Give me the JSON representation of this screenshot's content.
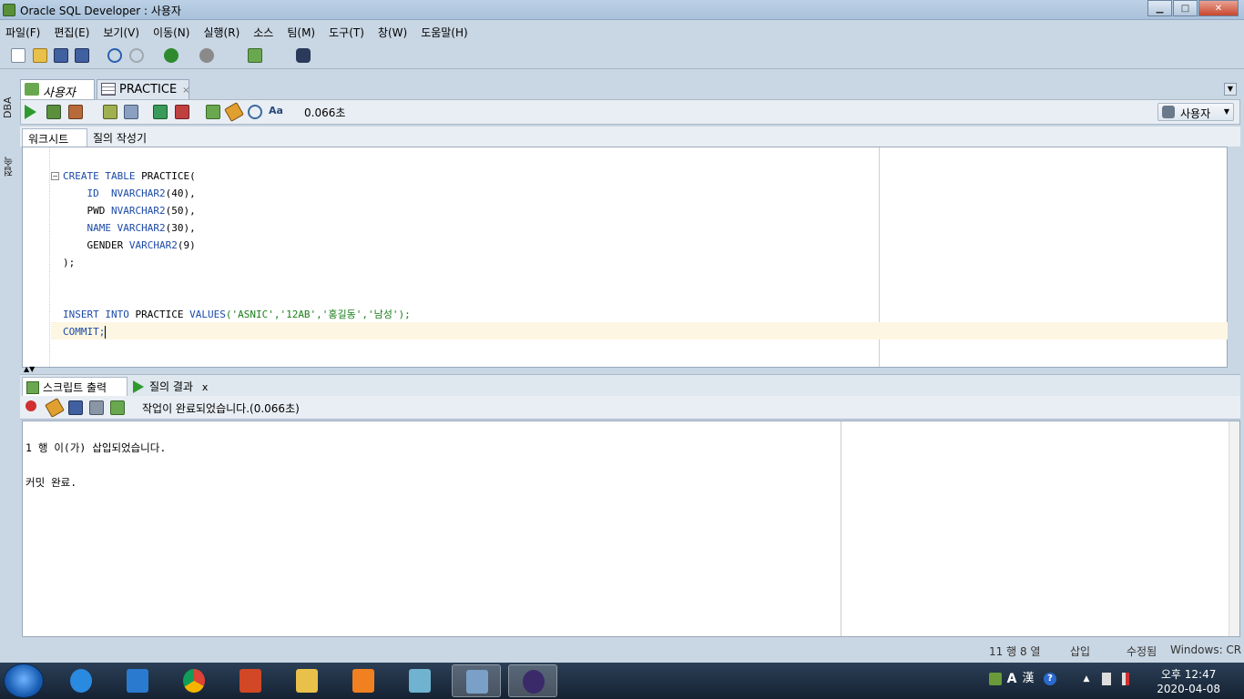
{
  "window": {
    "title": "Oracle SQL Developer : 사용자",
    "minimize": "▁",
    "maximize": "□",
    "close": "✕"
  },
  "menu": [
    "파일(F)",
    "편집(E)",
    "보기(V)",
    "이동(N)",
    "실행(R)",
    "소스",
    "팀(M)",
    "도구(T)",
    "창(W)",
    "도움말(H)"
  ],
  "side_tabs": [
    "DBA",
    "접속"
  ],
  "editor_tabs": [
    {
      "label": "사용자",
      "close": "×"
    },
    {
      "label": "PRACTICE",
      "close": "×"
    }
  ],
  "editor_toolbar": {
    "timing": "0.066초",
    "connection": "사용자"
  },
  "sub_tabs": [
    "워크시트",
    "질의 작성기"
  ],
  "code_lines": {
    "l1_kw": "CREATE TABLE",
    "l1_rest": " PRACTICE(",
    "l2_col": "ID",
    "l2_type": "NVARCHAR2",
    "l2_rest": "(40),",
    "l3_col": "PWD",
    "l3_type": "NVARCHAR2",
    "l3_rest": "(50),",
    "l4_col": "NAME",
    "l4_type": "VARCHAR2",
    "l4_rest": "(30),",
    "l5_col": "GENDER",
    "l5_type": "VARCHAR2",
    "l5_rest": "(9)",
    "l6": ");",
    "l9_kw1": "INSERT INTO",
    "l9_tbl": " PRACTICE ",
    "l9_kw2": "VALUES",
    "l9_vals": "('ASNIC','12AB','홍길동','남성');",
    "l10": "COMMIT;"
  },
  "bottom_tabs": [
    {
      "label": "스크립트 출력",
      "close": "x"
    },
    {
      "label": "질의 결과",
      "close": "x"
    }
  ],
  "output": {
    "status": "작업이 완료되었습니다.(0.066초)",
    "line1": "1 행 이(가) 삽입되었습니다.",
    "line2": "커밋 완료."
  },
  "statusbar": {
    "position": "11 행 8 열",
    "mode": "삽입",
    "modified": "수정됨",
    "eol": "Windows: CR"
  },
  "taskbar": {
    "ime1": "A",
    "ime2": "漢",
    "help": "?",
    "time": "오후 12:47",
    "date": "2020-04-08"
  },
  "colors": {
    "keyword": "#1c4aa8",
    "string": "#1a7f1a",
    "current_line": "#fdf6e2"
  }
}
